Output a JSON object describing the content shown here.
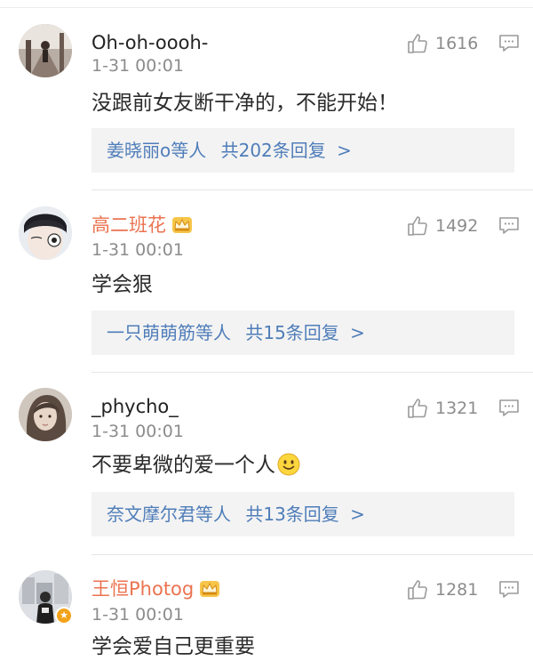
{
  "comments": [
    {
      "username": "Oh-oh-oooh-",
      "timestamp": "1-31 00:01",
      "likes": "1616",
      "text": "没跟前女友断干净的，不能开始！",
      "vip": false,
      "replies": {
        "prefix": "姜晓丽o等人",
        "count_text": "共202条回复",
        "arrow": ">"
      }
    },
    {
      "username": "高二班花",
      "timestamp": "1-31 00:01",
      "likes": "1492",
      "text": "学会狠",
      "vip": true,
      "replies": {
        "prefix": "一只萌萌筋等人",
        "count_text": "共15条回复",
        "arrow": ">"
      }
    },
    {
      "username": "_phycho_",
      "timestamp": "1-31 00:01",
      "likes": "1321",
      "text": "不要卑微的爱一个人",
      "text_emoji": "smile-emoji",
      "vip": false,
      "replies": {
        "prefix": "奈文摩尔君等人",
        "count_text": "共13条回复",
        "arrow": ">"
      }
    },
    {
      "username": "王恒Photog",
      "timestamp": "1-31 00:01",
      "likes": "1281",
      "text": "学会爱自己更重要",
      "vip": true,
      "verified_badge": true
    }
  ],
  "colors": {
    "vip_name": "#eb7350",
    "normal_name": "#222222",
    "meta": "#8c8c8c",
    "reply_link": "#4f7db9",
    "reply_bg": "#f3f3f3"
  },
  "icons": {
    "like": "thumbs-up-icon",
    "reply": "comment-bubble-icon",
    "vip": "crown-icon",
    "verified": "verified-badge-icon"
  }
}
